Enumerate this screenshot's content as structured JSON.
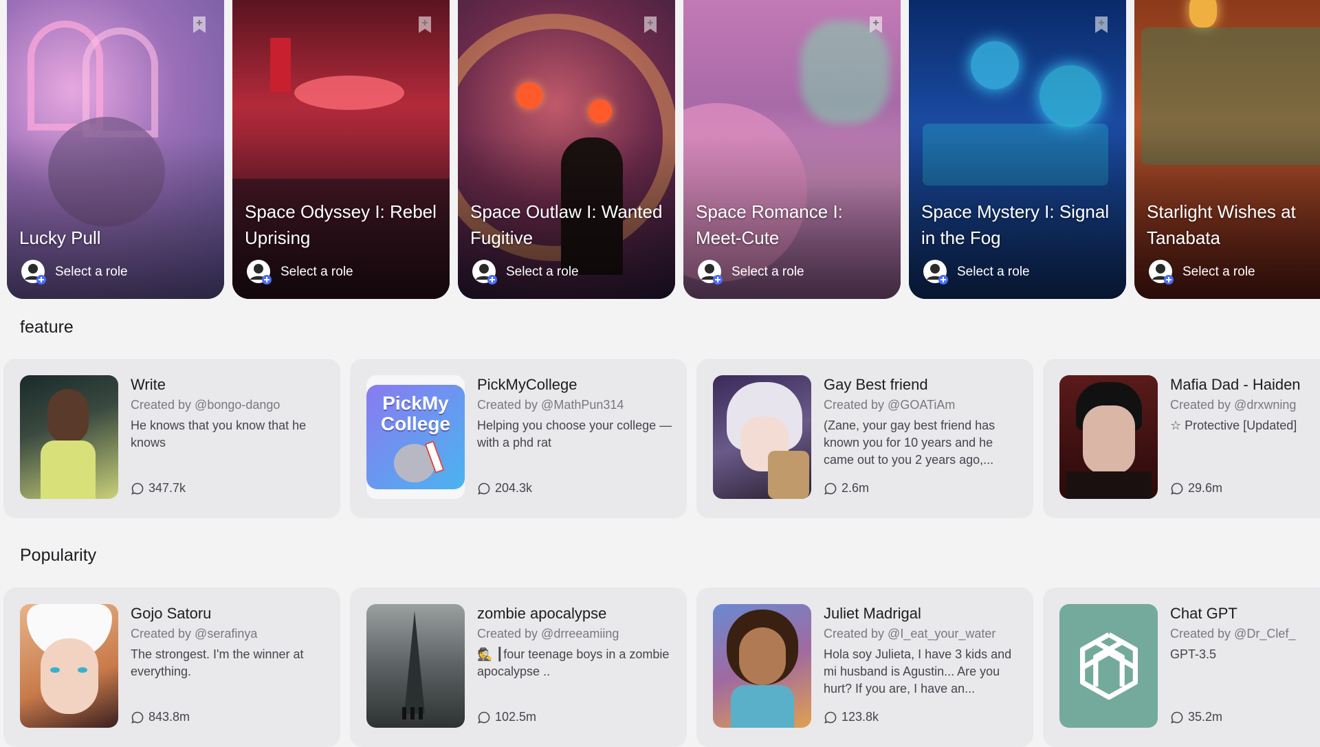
{
  "scenarios": [
    {
      "title": "Lucky Pull",
      "role_label": "Select a role",
      "bg": "#8e6fa6",
      "accent": "#d79ad8"
    },
    {
      "title": "Space Odyssey I: Rebel Uprising",
      "role_label": "Select a role",
      "bg": "#7a1f2e",
      "accent": "#f25a6a"
    },
    {
      "title": "Space Outlaw I: Wanted Fugitive",
      "role_label": "Select a role",
      "bg": "#5a2a3c",
      "accent": "#ff7a3a"
    },
    {
      "title": "Space Romance I: Meet-Cute",
      "role_label": "Select a role",
      "bg": "#9c5b8c",
      "accent": "#7ee0b0"
    },
    {
      "title": "Space Mystery I: Signal in the Fog",
      "role_label": "Select a role",
      "bg": "#1f3a7a",
      "accent": "#39c0e8"
    },
    {
      "title": "Starlight Wishes at Tanabata",
      "role_label": "Select a role",
      "bg": "#7a2a1f",
      "accent": "#e88a3a"
    }
  ],
  "sections": {
    "feature": {
      "title": "feature",
      "cards": [
        {
          "name": "Write",
          "creator": "Created by @bongo-dango",
          "desc": "He knows that you know that he knows",
          "count": "347.7k",
          "thumb": "#3b4a3c"
        },
        {
          "name": "PickMyCollege",
          "creator": "Created by @MathPun314",
          "desc": "Helping you choose your college — with a phd rat",
          "count": "204.3k",
          "thumb": "#6fa8f0",
          "thumb_text_1": "PickMy",
          "thumb_text_2": "College"
        },
        {
          "name": "Gay Best friend",
          "creator": "Created by @GOATiAm",
          "desc": "(Zane, your gay best friend has known you for 10 years and he came out to you 2 years ago,...",
          "count": "2.6m",
          "thumb": "#4a3b6a"
        },
        {
          "name": "Mafia Dad - Haiden",
          "creator": "Created by @drxwning",
          "desc": "☆ Protective [Updated]",
          "count": "29.6m",
          "thumb": "#3a1a1a"
        }
      ]
    },
    "popularity": {
      "title": "Popularity",
      "cards": [
        {
          "name": "Gojo Satoru",
          "creator": "Created by @serafinya",
          "desc": "The strongest. I'm the winner at everything.",
          "count": "843.8m",
          "thumb": "#d9a37a"
        },
        {
          "name": "zombie apocalypse",
          "creator": "Created by @drreeamiing",
          "desc": "🕵 ┃four teenage boys in a zombie apocalypse ..",
          "count": "102.5m",
          "thumb": "#5b6263"
        },
        {
          "name": "Juliet Madrigal",
          "creator": "Created by @I_eat_your_water",
          "desc": "Hola soy Julieta, I have 3 kids and mi husband is Agustin... Are you hurt? If you are, I have an...",
          "count": "123.8k",
          "thumb": "#8a5a8a"
        },
        {
          "name": "Chat GPT",
          "creator": "Created by @Dr_Clef_",
          "desc": "GPT-3.5",
          "count": "35.2m",
          "thumb": "#74aa9c"
        }
      ]
    }
  }
}
